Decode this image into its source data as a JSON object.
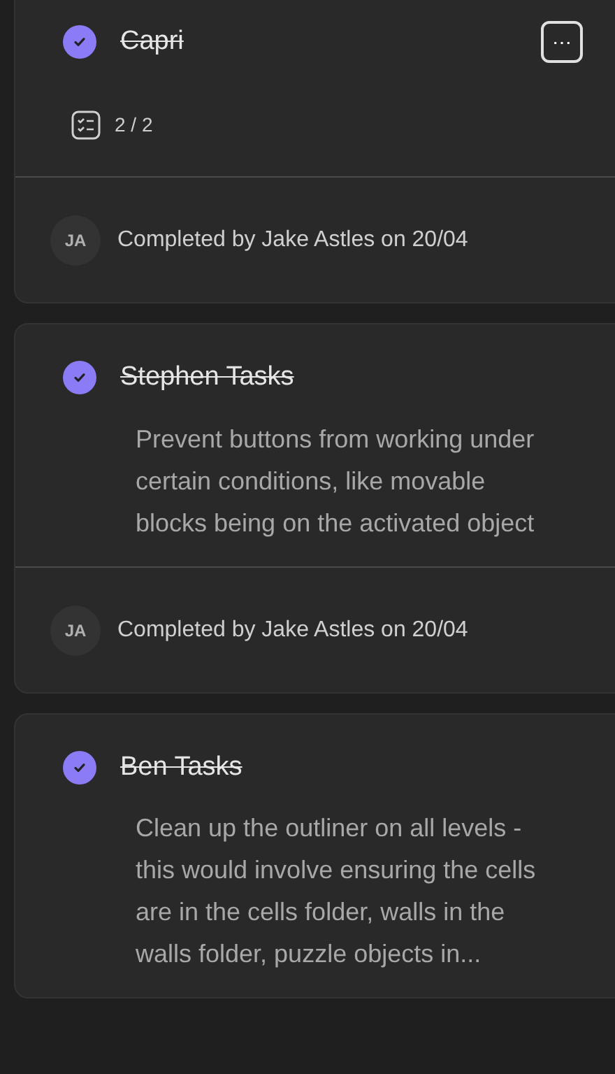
{
  "tasks": [
    {
      "title": "Capri",
      "completed": true,
      "more_button": "⋯",
      "checklist": "2 / 2",
      "footer": {
        "initials": "JA",
        "text": "Completed by Jake Astles on 20/04"
      }
    },
    {
      "title": "Stephen Tasks",
      "completed": true,
      "description": "Prevent buttons from working under certain conditions, like movable blocks being on the activated object",
      "footer": {
        "initials": "JA",
        "text": "Completed by Jake Astles on 20/04"
      }
    },
    {
      "title": "Ben Tasks",
      "completed": true,
      "description": "Clean up the outliner on all levels - this would involve ensuring the cells are in the cells folder, walls in the walls folder, puzzle objects in..."
    }
  ]
}
